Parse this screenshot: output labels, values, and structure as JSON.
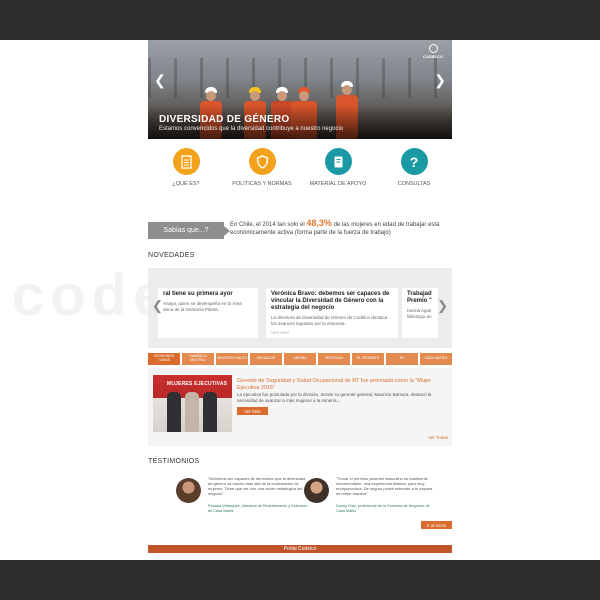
{
  "hero": {
    "title": "DIVERSIDAD DE GÉNERO",
    "subtitle": "Estamos convencidos que la diversidad contribuye a nuestro negocio",
    "logo_text": "CODELCO"
  },
  "features": [
    {
      "label": "¿QUÉ ES?",
      "icon": "document-icon",
      "color": "#f2a31b"
    },
    {
      "label": "POLÍTICAS Y NORMAS",
      "icon": "shield-icon",
      "color": "#f2a31b"
    },
    {
      "label": "MATERIAL DE APOYO",
      "icon": "book-icon",
      "color": "#1b9aa6"
    },
    {
      "label": "CONSULTAS",
      "icon": "question-icon",
      "color": "#1b9aa6"
    }
  ],
  "sabias": {
    "tag": "Sabías que...?",
    "fact_pre": "En Chile, el 2014 tan solo el ",
    "fact_pct": "48,3%",
    "fact_post": " de las mujeres en edad de trabajar está económicamente  activa (forma parte de la fuerza de trabajo)"
  },
  "novedades": {
    "title": "NOVEDADES",
    "cards": [
      {
        "title": "ral tiene su primera ayor",
        "desc": "Anaya, quien se desempeña en la Área Seca de la Gerencia Planta",
        "more": ""
      },
      {
        "title": "Verónica Bravo: debemos ser capaces de vincular la Diversidad de Género con la estrategia del negocio",
        "desc": "La directora de Diversidad de Género de Codelco destaca los avances logrados por la empresa.",
        "more": "VER MÁS"
      },
      {
        "title": "Trabajad Premio \"",
        "desc": "Karina Aguir liderazgo an",
        "more": ""
      }
    ]
  },
  "tabs": [
    "DIVISIONES TOMAS",
    "GABRIELA MISTRAL",
    "MINISTRO HALES",
    "SALVADOR",
    "ANDINA",
    "VENTANAS",
    "EL TENIENTE",
    "RT",
    "CASA MATRIZ"
  ],
  "news": {
    "photo_banner": "MUJERES EJECUTIVAS",
    "title": "Gerente de Seguridad y Salud Ocupacional de RT fue premiada como la \"Mujer Ejecutiva 2015\"",
    "text": "La ejecutiva fue postulada por la división, donde su gerente general, Mauricio Barraza, destacó la necesidad de avanzar a más mujeres a la minería...",
    "more": "Ver Más",
    "all": "Ver Todas"
  },
  "testimonios": {
    "title": "TESTIMONIOS",
    "items": [
      {
        "quote": "\"Debemos ser capaces de demostrar que la diversidad de género va mucho más allá de la contratación de mujeres. Tiene que ver con una visión estratégica del negocio\"",
        "author": "Rosana Velásquez, directora de Reclutamiento y Selección de Casa Matriz"
      },
      {
        "quote": "\"Tomar el permiso parental masculino es totalmente recomendable, una experiencia distinta, para muy enriquecedora. De seguro podrá entender a tu esposa de mejor manera\"",
        "author": "Danny Díaz, profesional de la Gerencia de Negocios de Casa Matriz"
      }
    ],
    "button": "Ir al inicio"
  },
  "footer": {
    "label": "Portal Codelco"
  },
  "watermark": "codelco"
}
